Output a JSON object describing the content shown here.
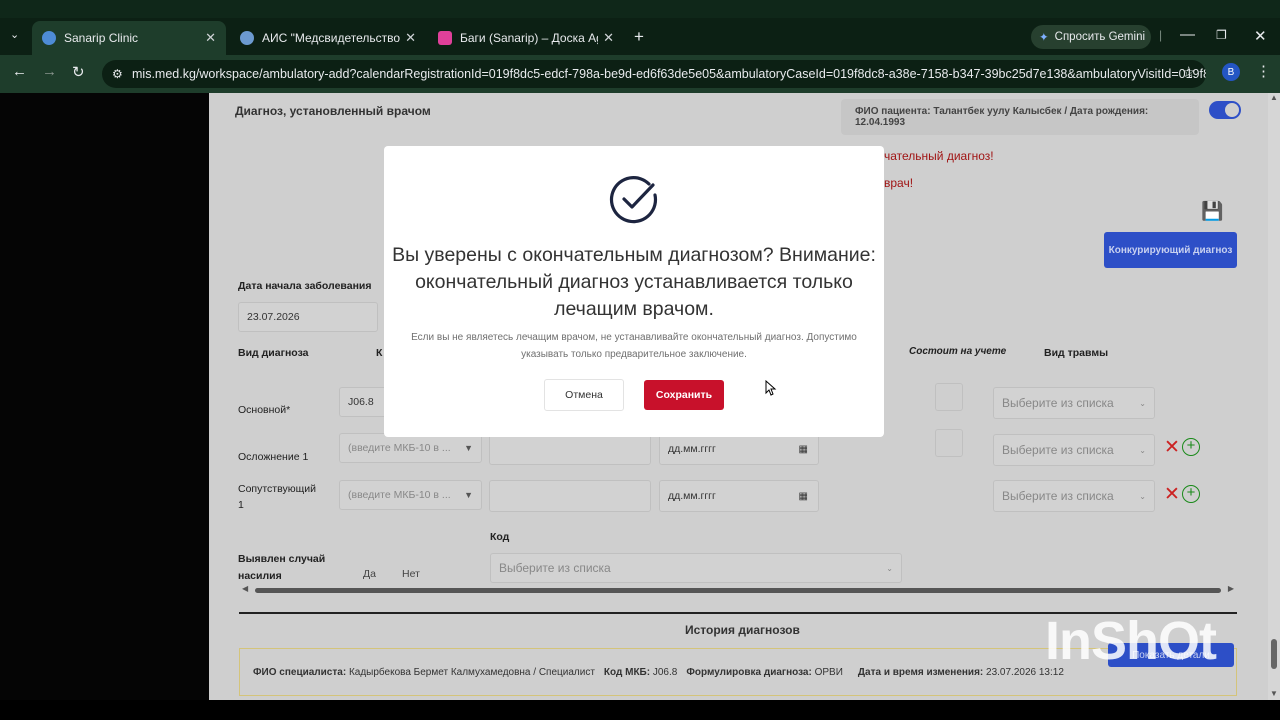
{
  "browser": {
    "tabs": [
      {
        "label": "Sanarip Clinic",
        "active": true
      },
      {
        "label": "АИС \"Медсвидетельство\"",
        "active": false
      },
      {
        "label": "Баги (Sanarip) – Доска Agile Yo",
        "active": false
      }
    ],
    "gemini_label": "Спросить Gemini",
    "url": "mis.med.kg/workspace/ambulatory-add?calendarRegistrationId=019f8dc5-edcf-798a-be9d-ed6f63de5e05&ambulatoryCaseId=019f8dc8-a38e-7158-b347-39bc25d7e138&ambulatoryVisitId=019f8dc8...",
    "profile_initial": "B"
  },
  "page": {
    "section_title": "Диагноз, установленный врачом",
    "patient_info": "ФИО пациента: Талантбек уулу Калысбек / Дата рождения: 12.04.1993",
    "warning1": "чательный диагноз!",
    "warning2": "врач!",
    "competing_button": "Конкурирующий диагноз",
    "onset_label": "Дата начала заболевания",
    "onset_value": "23.07.2026",
    "col_diag_type": "Вид диагноза",
    "col_k": "К",
    "col_registered": "Состоит на учете",
    "col_trauma": "Вид травмы",
    "row_main": "Основной*",
    "row_main_code": "J06.8",
    "row_complication": "Осложнение 1",
    "row_concomitant": "Сопутствующий 1",
    "mkb_placeholder": "(введите МКБ-10 в ...",
    "date_placeholder": "дд.мм.гггг",
    "select_placeholder": "Выберите из списка",
    "violence_label": "Выявлен случай насилия",
    "yes": "Да",
    "no": "Нет",
    "code_label": "Код",
    "history_title": "История диагнозов",
    "history_specialist_label": "ФИО специалиста:",
    "history_specialist": "Кадырбекова Бермет Калмухамедовна / Специалист",
    "history_mkb_label": "Код МКБ:",
    "history_mkb": "J06.8",
    "history_formulation_label": "Формулировка диагноза:",
    "history_formulation": "ОРВИ",
    "history_date_label": "Дата и время изменения:",
    "history_date": "23.07.2026 13:12",
    "show_more": "Показать детали"
  },
  "modal": {
    "title": "Вы уверены с окончательным диагнозом? Внимание: окончательный диагноз устанавливается только лечащим врачом.",
    "subtitle": "Если вы не являетесь лечащим врачом, не устанавливайте окончательный диагноз. Допустимо указывать только предварительное заключение.",
    "cancel": "Отмена",
    "save": "Сохранить"
  },
  "watermark": "InShOt",
  "colors": {
    "accent": "#c8112b",
    "primary": "#2d4fc7",
    "browser_bg": "#1e3d2b"
  }
}
